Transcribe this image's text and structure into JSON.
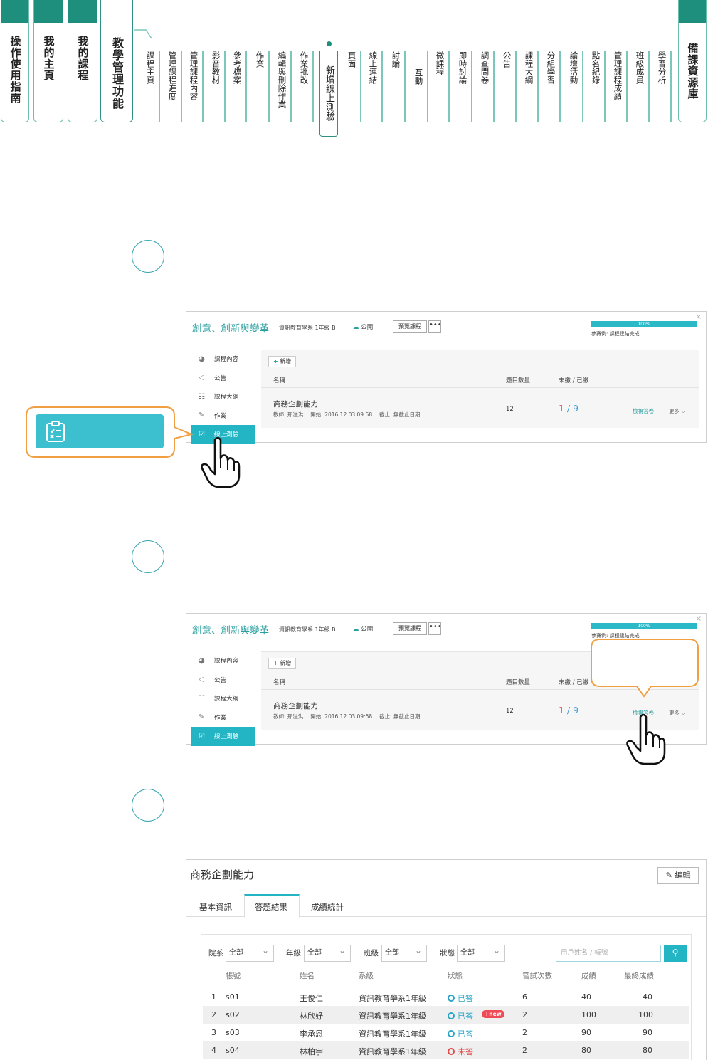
{
  "top_tabs": [
    "操作使用指南",
    "我的主頁",
    "我的課程",
    "教學管理功能"
  ],
  "right_tab": "備課資源庫",
  "nav_items": [
    "課程主頁",
    "管理課程進度",
    "管理課程內容",
    "影音教材",
    "參考檔案",
    "作業",
    "編輯與刪除作業",
    "作業批改",
    "新增線上測驗",
    "頁面",
    "線上連結",
    "討論",
    "互動",
    "微課程",
    "即時討論",
    "調查問卷",
    "公告",
    "課程大綱",
    "分組學習",
    "論壇活動",
    "點名紀錄",
    "管理課程成績",
    "班級成員",
    "學習分析"
  ],
  "active_nav": "新增線上測驗",
  "course": {
    "title": "創意、創新與變革",
    "dept": "資訊教育學系 1年級 B",
    "visibility": "公開",
    "preview_btn": "預覽課程",
    "more_btn": "•••",
    "progress_pct": "100%",
    "progress_value": 1.0,
    "progress_note": "參賽例: 課程建結完成",
    "close": "×"
  },
  "sidebar": [
    {
      "icon": "course-content-icon",
      "glyph": "◕",
      "label": "課程內容"
    },
    {
      "icon": "announcement-icon",
      "glyph": "◁",
      "label": "公告"
    },
    {
      "icon": "syllabus-icon",
      "glyph": "☷",
      "label": "課程大綱"
    },
    {
      "icon": "homework-icon",
      "glyph": "✎",
      "label": "作業"
    },
    {
      "icon": "online-quiz-icon",
      "glyph": "☑",
      "label": "線上測驗"
    }
  ],
  "table": {
    "add_label": "新增",
    "add_plus": "+",
    "col_name": "名稱",
    "col_count": "題目數量",
    "col_submit": "未繳 / 已繳",
    "quiz_name": "商務企劃能力",
    "quiz_meta": "教師: 邢溢洪　 開始: 2016.12.03 09:58　 截止: 無截止日期",
    "quiz_count": "12",
    "unsubmitted": "1",
    "slash": " / ",
    "submitted": "9",
    "view_link": "檢視答卷",
    "more_link": "更多 ⌵"
  },
  "result": {
    "title": "商務企劃能力",
    "edit_btn": "編輯",
    "edit_icon": "✎",
    "tabs": [
      "基本資訊",
      "答題結果",
      "成績統計"
    ],
    "filters": [
      {
        "label": "院系",
        "value": "全部"
      },
      {
        "label": "年級",
        "value": "全部"
      },
      {
        "label": "班級",
        "value": "全部"
      },
      {
        "label": "狀態",
        "value": "全部"
      }
    ],
    "search_placeholder": "用戶姓名 / 帳號",
    "search_icon": "⚲",
    "headers": [
      "帳號",
      "姓名",
      "系級",
      "狀態",
      "嘗試次數",
      "成績",
      "最終成績"
    ],
    "rows": [
      {
        "no": "1",
        "account": "s01",
        "name": "王俊仁",
        "dept": "資訊教育學系1年級",
        "status": "已答",
        "tries": "6",
        "score": "40",
        "final": "40"
      },
      {
        "no": "2",
        "account": "s02",
        "name": "林欣妤",
        "dept": "資訊教育學系1年級",
        "status": "已答",
        "badge": "+new",
        "tries": "2",
        "score": "100",
        "final": "100"
      },
      {
        "no": "3",
        "account": "s03",
        "name": "李承恩",
        "dept": "資訊教育學系1年級",
        "status": "已答",
        "tries": "2",
        "score": "90",
        "final": "90"
      },
      {
        "no": "4",
        "account": "s04",
        "name": "林柏宇",
        "dept": "資訊教育學系1年級",
        "status": "未答",
        "tries": "2",
        "score": "80",
        "final": "80"
      }
    ]
  }
}
